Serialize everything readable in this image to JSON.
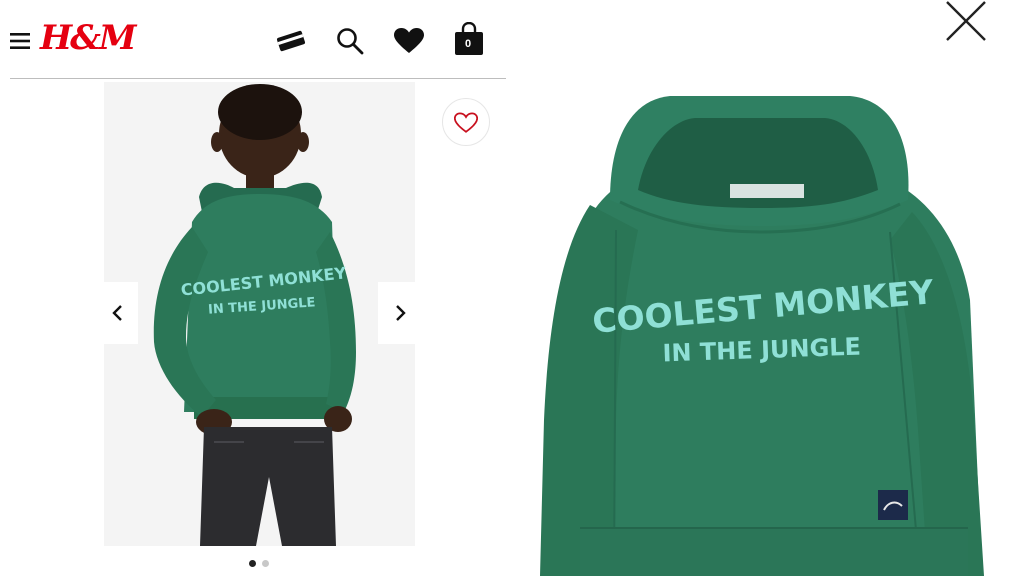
{
  "header": {
    "brand": "H&M",
    "bag_count": "0",
    "icons": [
      "menu-icon",
      "card-icon",
      "search-icon",
      "heart-icon",
      "shopping-bag-icon"
    ]
  },
  "gallery": {
    "shirt_print_line1": "COOLEST MONKEY",
    "shirt_print_line2": "IN THE JUNGLE",
    "slide_count": 2,
    "active_slide": 1
  },
  "detail": {
    "print_line1": "COOLEST MONKEY",
    "print_line2": "IN THE JUNGLE",
    "close_icon": "close-icon"
  },
  "colors": {
    "brand_red": "#e50010",
    "hoodie_green": "#2e7d5e",
    "print_mint": "#8fe0d6"
  }
}
